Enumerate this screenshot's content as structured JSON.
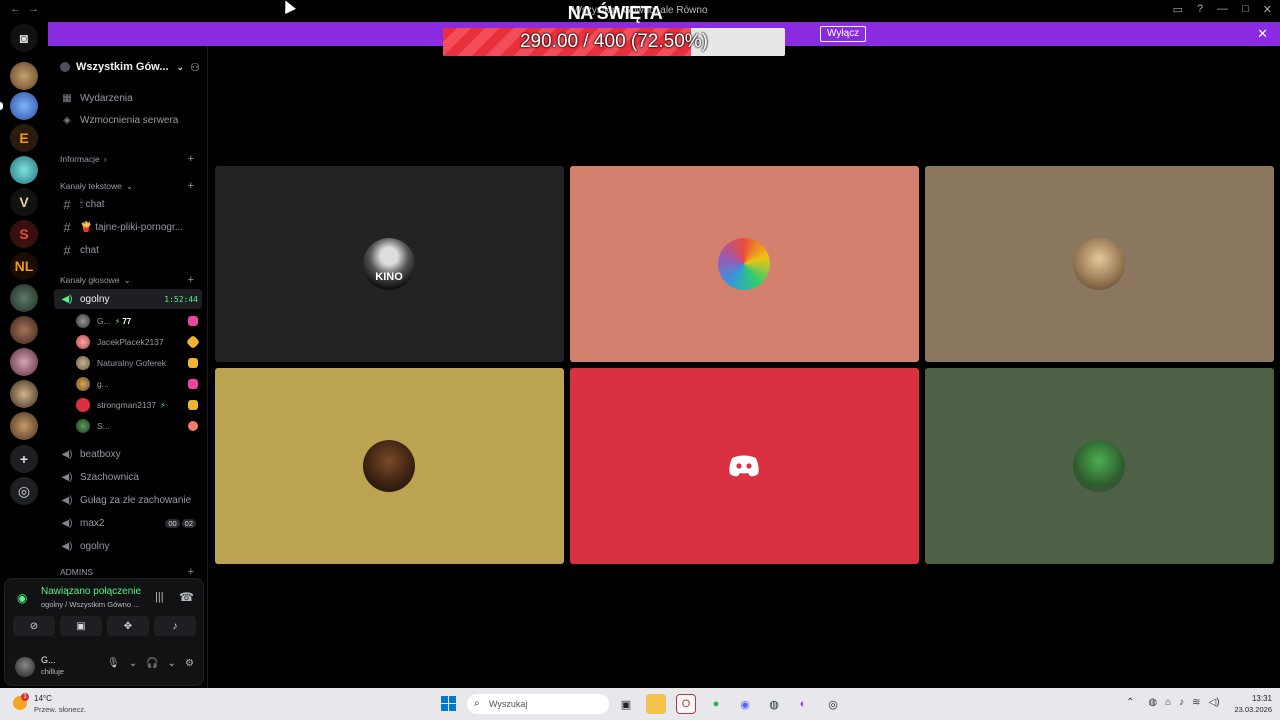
{
  "window": {
    "title": "Wszystkim Gówno, ale Równo"
  },
  "overlay": {
    "title": "NA ŚWIĘTA",
    "progress_text": "290.00 / 400 (72.50%)",
    "progress_fraction": 0.725
  },
  "banner": {
    "button_label": "Wyłącz",
    "close": "✕"
  },
  "server": {
    "name": "Wszystkim Gów..."
  },
  "sidebar": {
    "top_items": [
      {
        "label": "Wydarzenia"
      },
      {
        "label": "Wzmocnienia serwera"
      }
    ],
    "categories": {
      "info": "Informacje",
      "text": "Kanały tekstowe",
      "voice": "Kanały głosowe",
      "admins": "ADMINS"
    },
    "text_channels": [
      {
        "label": "🕯 chat"
      },
      {
        "label": "🍟 tajne-pliki-pornogr..."
      },
      {
        "label": "chat"
      }
    ],
    "active_voice": {
      "label": "ogolny",
      "timer": "1:52:44"
    },
    "members": [
      {
        "name": "G...",
        "level": "77"
      },
      {
        "name": "JacekPlacek2137"
      },
      {
        "name": "Naturalny Goferek"
      },
      {
        "name": "g..."
      },
      {
        "name": "strongman2137"
      },
      {
        "name": "S..."
      }
    ],
    "voice_channels": [
      {
        "label": "beatboxy"
      },
      {
        "label": "Szachownica"
      },
      {
        "label": "Gułag za złe zachowanie"
      },
      {
        "label": "max2",
        "badge_a": "00",
        "badge_b": "02"
      },
      {
        "label": "ogolny"
      }
    ]
  },
  "voice_panel": {
    "status": "Nawiązano połączenie",
    "sub": "ogolny / Wszystkim Gówno ...",
    "user_name": "G...",
    "user_status": "chilluje"
  },
  "tiles": [
    {
      "color": "#232323",
      "label": "KINO"
    },
    {
      "color": "#d4806e"
    },
    {
      "color": "#8b7760"
    },
    {
      "color": "#bca352"
    },
    {
      "color": "#da3142"
    },
    {
      "color": "#4e6147"
    }
  ],
  "taskbar": {
    "temp": "14°C",
    "weather": "Przew. słonecz.",
    "search_placeholder": "Wyszukaj",
    "time": "13:31",
    "date": "23.03.2026"
  },
  "colors": {
    "accent_purple": "#8a2be2",
    "discord_blurple": "#5865f2",
    "online_green": "#57f287"
  }
}
